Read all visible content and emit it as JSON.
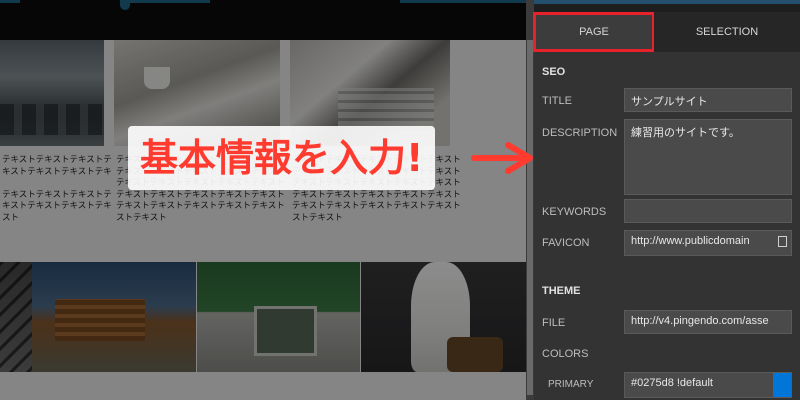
{
  "canvas": {
    "tiles_row1": [
      {
        "name": "office-photo",
        "style": "office"
      },
      {
        "name": "desk-photo",
        "style": "desk"
      },
      {
        "name": "papers-photo",
        "style": "papers"
      }
    ],
    "text_col1": "テキストテキストテキストテ\nキストテキストテキストテキ\n\nテキストテキストテキストテ\nキストテキストテキストテキ\nスト",
    "text_col2": "テキストテキストテキストテキストテキスト\nテキストテキストテキストテキストテキスト\nテキストテキストテキストテキストテキスト\nテキストテキストテキストテキストテキスト\nテキストテキストテキストテキストテキスト\nストテキスト",
    "text_col3": "テキストテキストテキストテキストテキスト\nテキストテキストテキストテキストテキスト\nテキストテキストテキストテキストテキスト\nテキストテキストテキストテキストテキスト\nテキストテキストテキストテキストテキスト\nストテキスト"
  },
  "panel": {
    "tabs": {
      "page": "PAGE",
      "selection": "SELECTION"
    },
    "seo": {
      "heading": "SEO",
      "title_label": "TITLE",
      "title_value": "サンプルサイト",
      "description_label": "DESCRIPTION",
      "description_value": "練習用のサイトです。",
      "keywords_label": "KEYWORDS",
      "keywords_value": "",
      "favicon_label": "FAVICON",
      "favicon_value": "http://www.publicdomain"
    },
    "theme": {
      "heading": "THEME",
      "file_label": "FILE",
      "file_value": "http://v4.pingendo.com/asse",
      "colors_label": "COLORS",
      "primary_label": "PRIMARY",
      "primary_value": "#0275d8 !default",
      "primary_color": "#0275d8"
    }
  },
  "annotation": {
    "text": "基本情報を入力!",
    "color": "#ff3b30",
    "highlight_color": "#e8212a"
  }
}
